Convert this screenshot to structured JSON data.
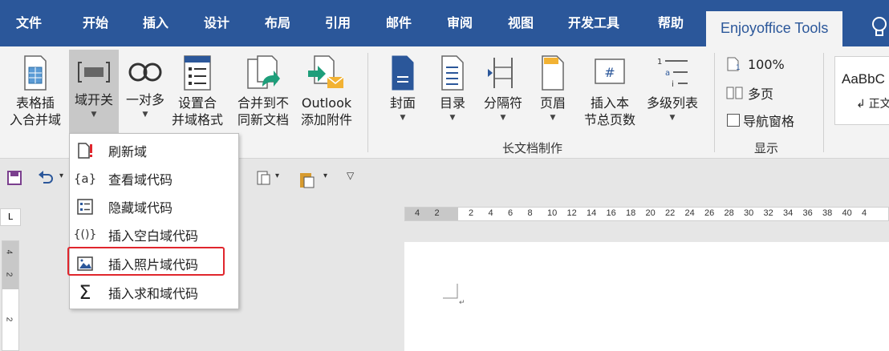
{
  "tabs": [
    "文件",
    "开始",
    "插入",
    "设计",
    "布局",
    "引用",
    "邮件",
    "审阅",
    "视图",
    "开发工具",
    "帮助",
    "Enjoyoffice Tools"
  ],
  "ribbon": {
    "buttons": [
      {
        "line1": "表格插",
        "line2": "入合并域",
        "icon": "table-merge-icon"
      },
      {
        "line1": "域开关",
        "line2": "",
        "icon": "field-toggle-icon",
        "has_chevron": true
      },
      {
        "line1": "一对多",
        "line2": "",
        "icon": "one-to-many-icon",
        "has_chevron": true
      },
      {
        "line1": "设置合",
        "line2": "并域格式",
        "icon": "merge-format-icon"
      },
      {
        "line1": "合并到不",
        "line2": "同新文档",
        "icon": "merge-new-doc-icon"
      },
      {
        "line1": "Outlook",
        "line2": "添加附件",
        "icon": "outlook-attach-icon"
      },
      {
        "line1": "封面",
        "line2": "",
        "icon": "cover-icon",
        "has_chevron": true
      },
      {
        "line1": "目录",
        "line2": "",
        "icon": "toc-icon",
        "has_chevron": true
      },
      {
        "line1": "分隔符",
        "line2": "",
        "icon": "separator-icon",
        "has_chevron": true
      },
      {
        "line1": "页眉",
        "line2": "",
        "icon": "header-icon",
        "has_chevron": true
      },
      {
        "line1": "插入本",
        "line2": "节总页数",
        "icon": "section-pages-icon"
      },
      {
        "line1": "多级列表",
        "line2": "",
        "icon": "multilevel-list-icon",
        "has_chevron": true
      }
    ],
    "groups": {
      "long_doc": "长文档制作",
      "display": "显示"
    },
    "display": {
      "zoom": "100%",
      "multipage": "多页",
      "nav_pane": "导航窗格"
    },
    "style_preview": "AaBbC",
    "style_sub": "↲ 正文"
  },
  "ruler": {
    "corner": "L",
    "ticks": [
      "4",
      "2",
      "2",
      "4",
      "6",
      "8",
      "10",
      "12",
      "14",
      "16",
      "18",
      "20",
      "22",
      "24",
      "26",
      "28",
      "30",
      "32",
      "34",
      "36",
      "38",
      "40",
      "4"
    ],
    "vticks": [
      "4",
      "2",
      "2"
    ]
  },
  "dropdown": {
    "items": [
      {
        "label": "刷新域",
        "icon": "refresh-field-icon"
      },
      {
        "label": "查看域代码",
        "icon": "view-code-icon"
      },
      {
        "label": "隐藏域代码",
        "icon": "hide-code-icon"
      },
      {
        "label": "插入空白域代码",
        "icon": "blank-field-icon"
      },
      {
        "label": "插入照片域代码",
        "icon": "photo-field-icon"
      },
      {
        "label": "插入求和域代码",
        "icon": "sum-field-icon"
      }
    ]
  },
  "colors": {
    "tabbar": "#2b579a",
    "ribbon": "#f3f3f3",
    "highlight": "#e0262d"
  }
}
